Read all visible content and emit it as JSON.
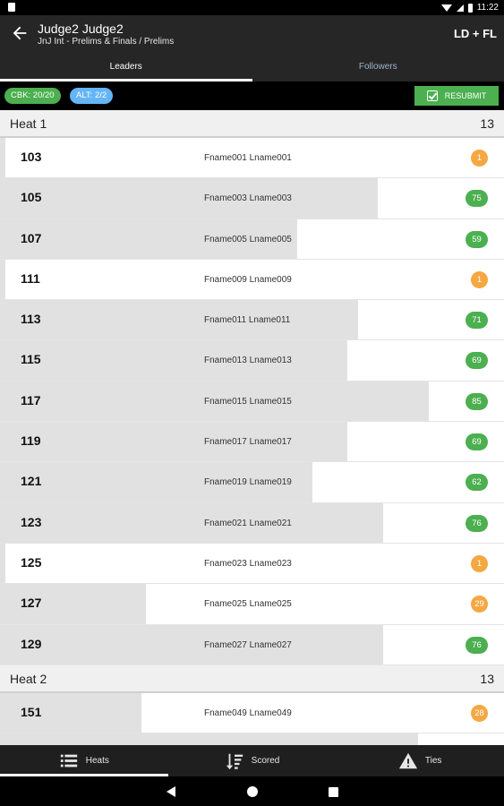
{
  "status_bar": {
    "time": "11:22"
  },
  "app_bar": {
    "title": "Judge2 Judge2",
    "subtitle": "JnJ Int - Prelims & Finals / Prelims",
    "role": "LD + FL"
  },
  "tabs": [
    {
      "label": "Leaders",
      "active": true
    },
    {
      "label": "Followers",
      "active": false
    }
  ],
  "chips": {
    "cbk": "CBK: 20/20",
    "alt": "ALT: 2/2"
  },
  "resubmit_label": "RESUBMIT",
  "heats": [
    {
      "title": "Heat 1",
      "count": "13",
      "rows": [
        {
          "bib": "103",
          "name": "Fname001 Lname001",
          "score": "1",
          "color": "orange",
          "fill": 0.01
        },
        {
          "bib": "105",
          "name": "Fname003 Lname003",
          "score": "75",
          "color": "green",
          "fill": 0.75
        },
        {
          "bib": "107",
          "name": "Fname005 Lname005",
          "score": "59",
          "color": "green",
          "fill": 0.59
        },
        {
          "bib": "111",
          "name": "Fname009 Lname009",
          "score": "1",
          "color": "orange",
          "fill": 0.01
        },
        {
          "bib": "113",
          "name": "Fname011 Lname011",
          "score": "71",
          "color": "green",
          "fill": 0.71
        },
        {
          "bib": "115",
          "name": "Fname013 Lname013",
          "score": "69",
          "color": "green",
          "fill": 0.69
        },
        {
          "bib": "117",
          "name": "Fname015 Lname015",
          "score": "85",
          "color": "green",
          "fill": 0.85
        },
        {
          "bib": "119",
          "name": "Fname017 Lname017",
          "score": "69",
          "color": "green",
          "fill": 0.69
        },
        {
          "bib": "121",
          "name": "Fname019 Lname019",
          "score": "62",
          "color": "green",
          "fill": 0.62
        },
        {
          "bib": "123",
          "name": "Fname021 Lname021",
          "score": "76",
          "color": "green",
          "fill": 0.76
        },
        {
          "bib": "125",
          "name": "Fname023 Lname023",
          "score": "1",
          "color": "orange",
          "fill": 0.01
        },
        {
          "bib": "127",
          "name": "Fname025 Lname025",
          "score": "29",
          "color": "orange",
          "fill": 0.29
        },
        {
          "bib": "129",
          "name": "Fname027 Lname027",
          "score": "76",
          "color": "green",
          "fill": 0.76
        }
      ]
    },
    {
      "title": "Heat 2",
      "count": "13",
      "rows": [
        {
          "bib": "151",
          "name": "Fname049 Lname049",
          "score": "28",
          "color": "orange",
          "fill": 0.28
        },
        {
          "bib": "",
          "name": "",
          "score": "",
          "color": "none",
          "fill": 0.83
        }
      ]
    }
  ],
  "bottom_nav": [
    {
      "label": "Heats",
      "icon": "list-icon",
      "active": true
    },
    {
      "label": "Scored",
      "icon": "sort-icon",
      "active": false
    },
    {
      "label": "Ties",
      "icon": "warning-icon",
      "active": false
    }
  ],
  "colors": {
    "green": "#4caf50",
    "orange": "#f5a742",
    "blue_chip": "#64b5f6",
    "bar": "#262626"
  }
}
